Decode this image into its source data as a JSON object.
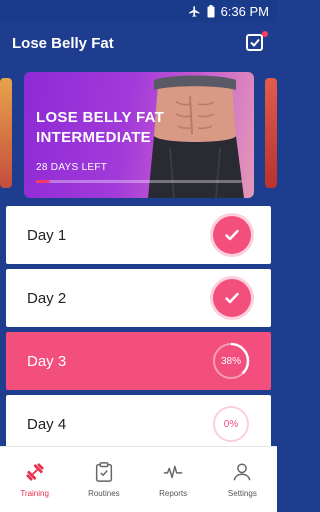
{
  "status_bar": {
    "time": "6:36 PM"
  },
  "app_bar": {
    "title": "Lose Belly Fat"
  },
  "banner": {
    "title": "LOSE BELLY FAT INTERMEDIATE",
    "days_left": "28 DAYS LEFT",
    "progress_fraction": 0.07
  },
  "days": [
    {
      "label": "Day 1",
      "state": "done"
    },
    {
      "label": "Day 2",
      "state": "done"
    },
    {
      "label": "Day 3",
      "state": "current",
      "progress_text": "38%",
      "progress": 0.38
    },
    {
      "label": "Day 4",
      "state": "upcoming",
      "progress_text": "0%",
      "progress": 0
    }
  ],
  "nav": [
    {
      "label": "Training",
      "icon": "dumbbell-icon",
      "active": true
    },
    {
      "label": "Routines",
      "icon": "clipboard-icon",
      "active": false
    },
    {
      "label": "Reports",
      "icon": "pulse-icon",
      "active": false
    },
    {
      "label": "Settings",
      "icon": "person-icon",
      "active": false
    }
  ],
  "colors": {
    "primary": "#1e3d8f",
    "accent": "#f24f7c",
    "active_nav": "#e8304f"
  }
}
